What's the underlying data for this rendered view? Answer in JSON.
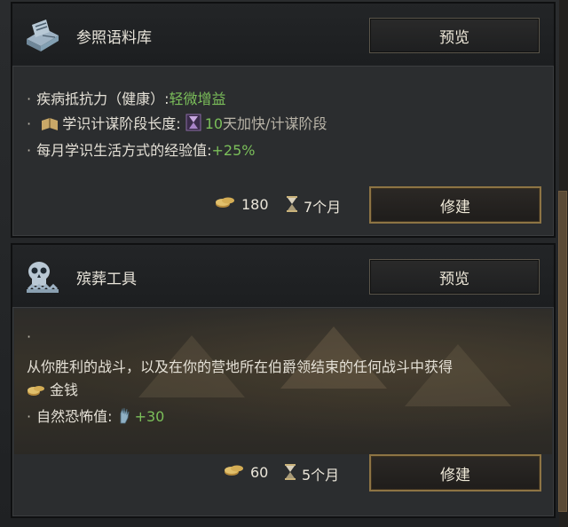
{
  "cards": [
    {
      "title": "参照语料库",
      "preview_label": "预览",
      "icon": "book-icon",
      "lines": [
        {
          "label": "疾病抵抗力（健康）:",
          "value": "轻微增益"
        },
        {
          "label": "学识计谋阶段长度:",
          "value": "10",
          "suffix": "天加快/计谋阶段"
        },
        {
          "label": "每月学识生活方式的经验值:",
          "value": "+25%"
        }
      ],
      "gold_cost": "180",
      "time_cost": "7个月",
      "build_label": "修建"
    },
    {
      "title": "殡葬工具",
      "preview_label": "预览",
      "icon": "skull-saw-icon",
      "dot": "·",
      "description": "从你胜利的战斗，以及在你的营地所在伯爵领结束的任何战斗中获得",
      "gold_text": "金钱",
      "lines": [
        {
          "label": "自然恐怖值:",
          "value": "+30"
        }
      ],
      "gold_cost": "60",
      "time_cost": "5个月",
      "build_label": "修建"
    }
  ],
  "colors": {
    "positive": "#7bbf5a",
    "gold_border": "#8d7444",
    "text": "#e4e0d6"
  }
}
